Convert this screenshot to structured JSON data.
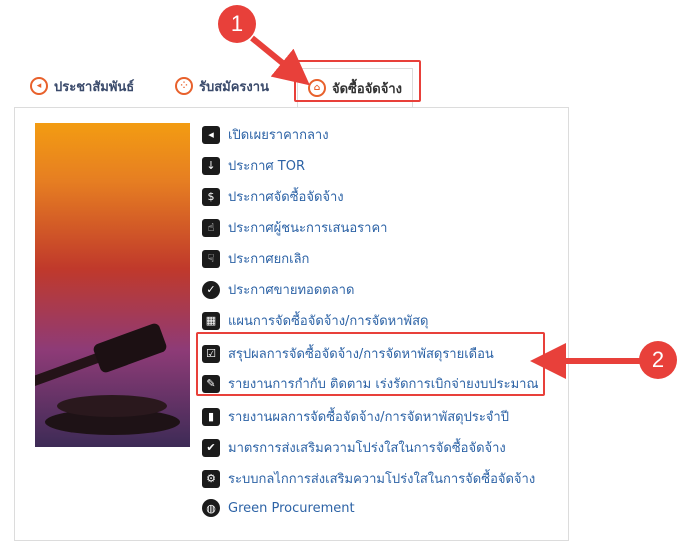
{
  "tabs": [
    {
      "label": "ประชาสัมพันธ์",
      "icon": "megaphone-icon",
      "active": false
    },
    {
      "label": "รับสมัครงาน",
      "icon": "people-icon",
      "active": false
    },
    {
      "label": "จัดซื้อจัดจ้าง",
      "icon": "bank-icon",
      "active": true
    }
  ],
  "menu": [
    {
      "label": "เปิดเผยราคากลาง",
      "icon": "megaphone-icon"
    },
    {
      "label": "ประกาศ TOR",
      "icon": "sort-numeric-icon"
    },
    {
      "label": "ประกาศจัดซื้อจัดจ้าง",
      "icon": "dollar-icon"
    },
    {
      "label": "ประกาศผู้ชนะการเสนอราคา",
      "icon": "thumbs-up-icon"
    },
    {
      "label": "ประกาศยกเลิก",
      "icon": "thumbs-down-icon"
    },
    {
      "label": "ประกาศขายทอดตลาด",
      "icon": "check-circle-icon"
    },
    {
      "label": "แผนการจัดซื้อจัดจ้าง/การจัดหาพัสดุ",
      "icon": "calendar-icon"
    },
    {
      "label": "สรุปผลการจัดซื้อจัดจ้าง/การจัดหาพัสดุรายเดือน",
      "icon": "check-square-icon"
    },
    {
      "label": "รายงานการกำกับ ติดตาม เร่งรัดการเบิกจ่ายงบประมาณ",
      "icon": "edit-icon"
    },
    {
      "label": "รายงานผลการจัดซื้อจัดจ้าง/การจัดหาพัสดุประจำปี",
      "icon": "bar-chart-icon"
    },
    {
      "label": "มาตรการส่งเสริมความโปร่งใสในการจัดซื้อจัดจ้าง",
      "icon": "tasks-icon"
    },
    {
      "label": "ระบบกลไกการส่งเสริมความโปร่งใสในการจัดซื้อจัดจ้าง",
      "icon": "gear-icon"
    },
    {
      "label": "Green Procurement",
      "icon": "globe-icon"
    }
  ],
  "annotations": {
    "step1": "1",
    "step2": "2",
    "color": "#e8403a"
  },
  "colors": {
    "link": "#2d63a6",
    "accent": "#e8612c"
  }
}
